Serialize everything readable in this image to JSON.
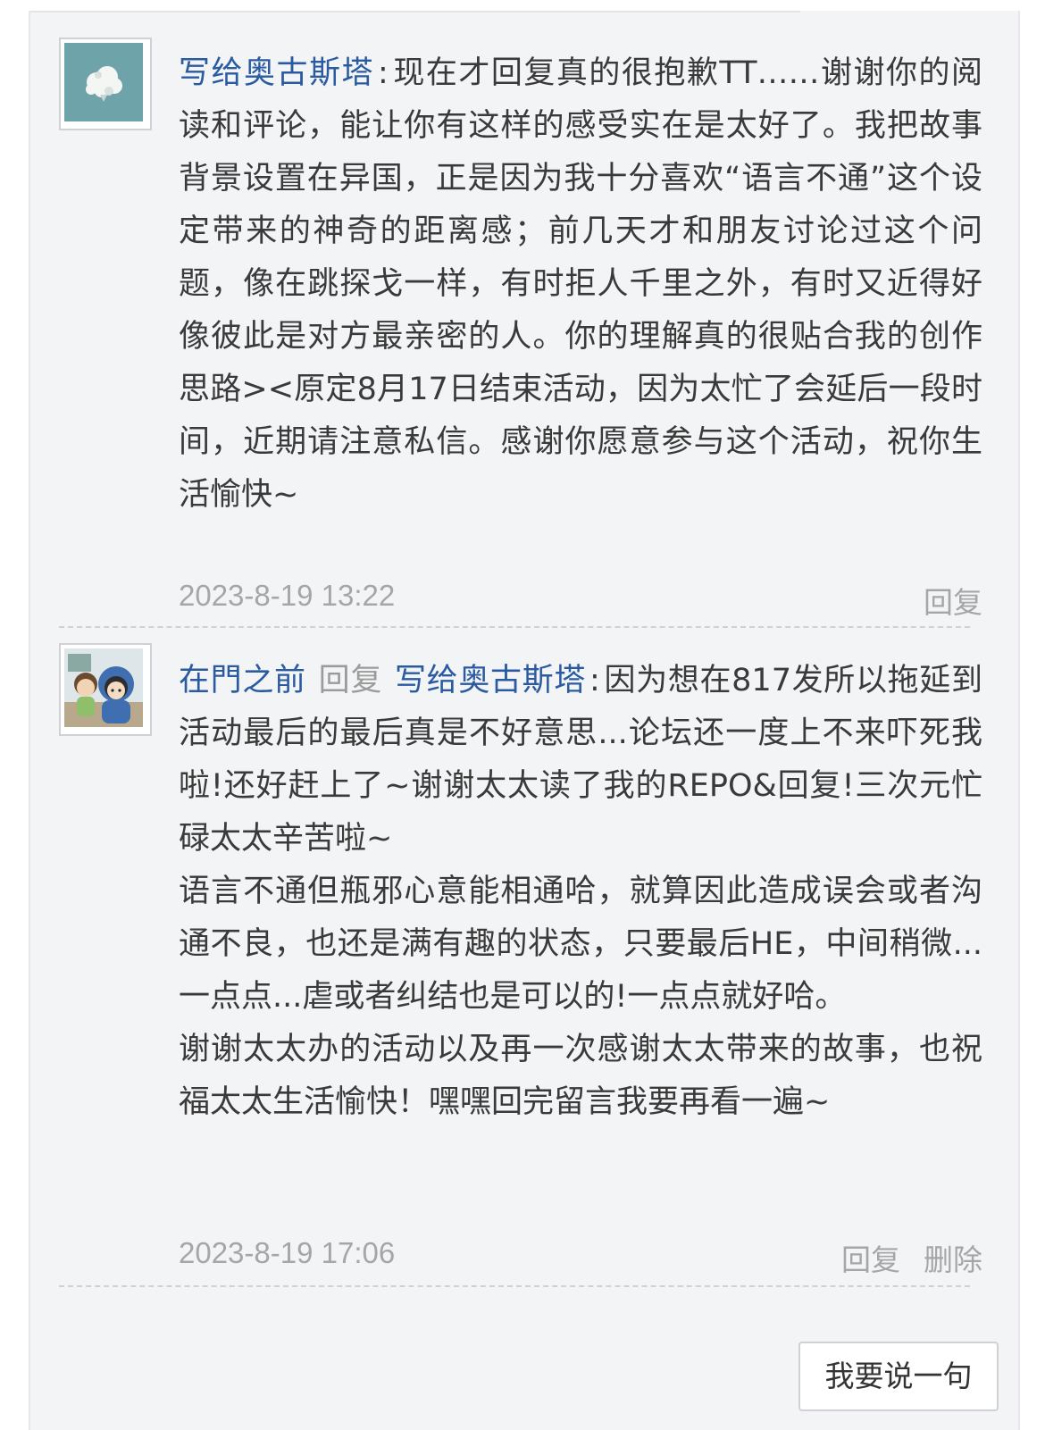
{
  "comments": [
    {
      "author": "写给奥古斯塔",
      "colon": ":",
      "paragraphs": [
        "现在才回复真的很抱歉TT……谢谢你的阅读和评论，能让你有这样的感受实在是太好了。我把故事背景设置在异国，正是因为我十分喜欢“语言不通”这个设定带来的神奇的距离感；前几天才和朋友讨论过这个问题，像在跳探戈一样，有时拒人千里之外，有时又近得好像彼此是对方最亲密的人。你的理解真的很贴合我的创作思路><原定8月17日结束活动，因为太忙了会延后一段时间，近期请注意私信。感谢你愿意参与这个活动，祝你生活愉快~"
      ],
      "timestamp": "2023-8-19 13:22",
      "actions": [
        "回复"
      ],
      "avatar_icon": "cloud-avatar-icon"
    },
    {
      "author": "在門之前",
      "reply_word": "回复",
      "reply_to": "写给奥古斯塔",
      "colon": ":",
      "paragraphs": [
        "因为想在817发所以拖延到活动最后的最后真是不好意思...论坛还一度上不来吓死我啦!还好赶上了~谢谢太太读了我的REPO&回复!三次元忙碌太太辛苦啦~",
        "语言不通但瓶邪心意能相通哈，就算因此造成误会或者沟通不良，也还是满有趣的状态，只要最后HE，中间稍微...一点点...虐或者纠结也是可以的!一点点就好哈。",
        "谢谢太太办的活动以及再一次感谢太太带来的故事，也祝福太太生活愉快！嘿嘿回完留言我要再看一遍~"
      ],
      "timestamp": "2023-8-19 17:06",
      "actions": [
        "回复",
        "删除"
      ],
      "avatar_icon": "chibi-characters-avatar-icon"
    }
  ],
  "say_button_label": "我要说一句",
  "colors": {
    "link": "#2a5aa0",
    "text": "#3a3a3a",
    "muted": "#a6a6a6",
    "panel_bg": "#f3f4f6"
  }
}
